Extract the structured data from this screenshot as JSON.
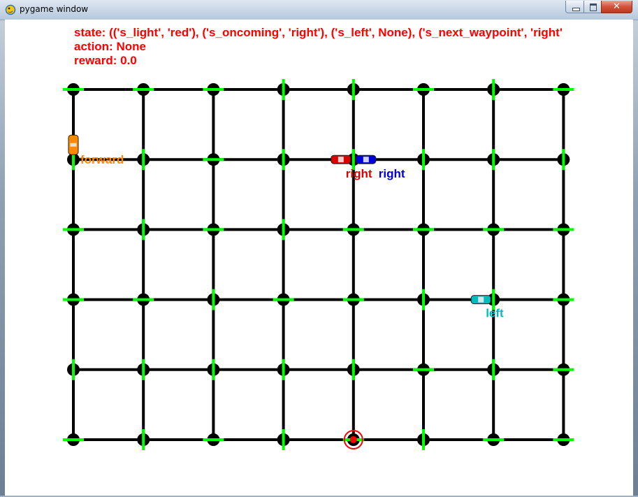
{
  "window": {
    "title": "pygame window",
    "icon": "pygame-snake-icon",
    "controls": [
      "minimize-icon",
      "maximize-icon",
      "close-icon"
    ]
  },
  "hud": {
    "state": "state: (('s_light', 'red'), ('s_oncoming', 'right'), ('s_left', None), ('s_next_waypoint', 'right'",
    "action": "action: None",
    "reward": "reward: 0.0"
  },
  "grid": {
    "columns": 8,
    "rows": 6,
    "road_color": "#000000",
    "signal_color": "#00ff00",
    "horizontal_green": [
      [
        1,
        1,
        1,
        0,
        0,
        1,
        0,
        1
      ],
      [
        0,
        0,
        1,
        0,
        0,
        0,
        0,
        0
      ],
      [
        1,
        0,
        1,
        0,
        1,
        1,
        1,
        1
      ],
      [
        1,
        1,
        0,
        1,
        1,
        0,
        0,
        1
      ],
      [
        0,
        0,
        0,
        0,
        0,
        1,
        0,
        1
      ],
      [
        1,
        0,
        1,
        0,
        1,
        0,
        1,
        1
      ]
    ]
  },
  "destination": {
    "col": 4,
    "row": 5,
    "color": "#ff0000"
  },
  "agents": [
    {
      "id": "orange",
      "label": "forward",
      "color": "#ff8800",
      "col": 0,
      "row": 1,
      "heading": "south",
      "label_side": "right"
    },
    {
      "id": "red",
      "label": "right",
      "color": "#dd0000",
      "col": 4,
      "row": 1,
      "heading": "west",
      "label_side": "below"
    },
    {
      "id": "blue",
      "label": "right",
      "color": "#0000dd",
      "col": 4,
      "row": 1,
      "heading": "east",
      "label_side": "below"
    },
    {
      "id": "cyan",
      "label": "left",
      "color": "#00bbbb",
      "col": 6,
      "row": 3,
      "heading": "west",
      "label_side": "below"
    }
  ]
}
